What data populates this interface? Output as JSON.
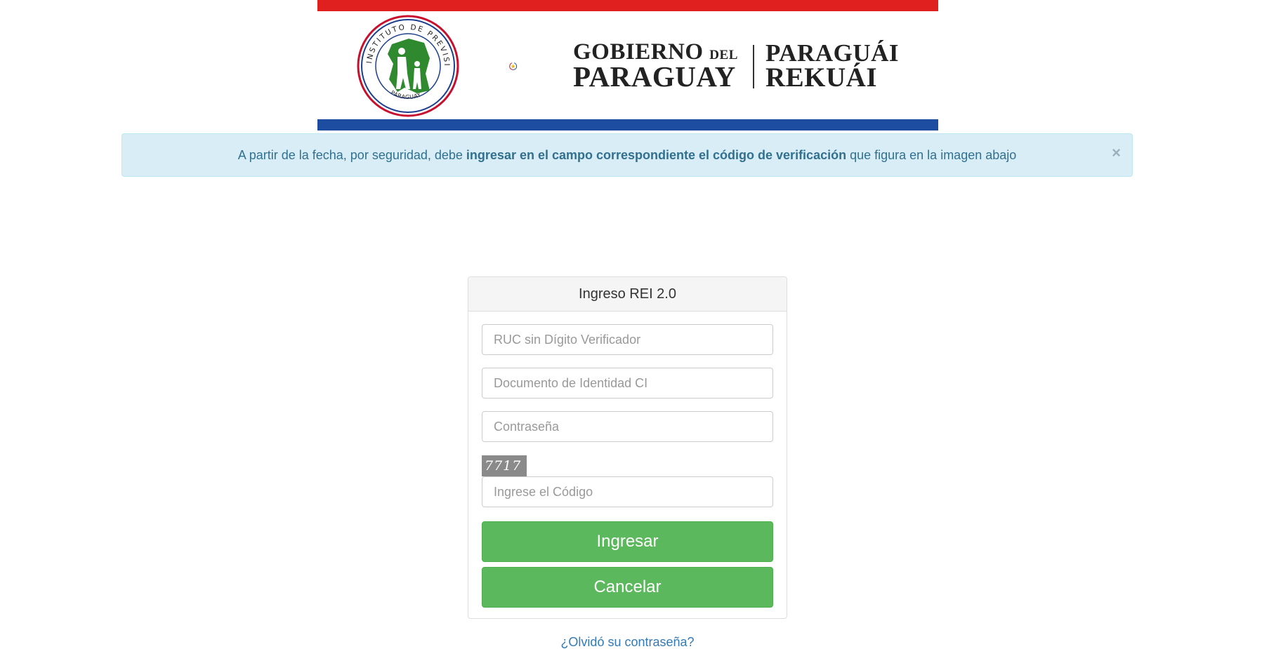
{
  "banner": {
    "ips_seal_text_top": "INSTITUTO DE PREVISION SOCIAL",
    "ips_seal_text_bottom": "PARAGUAY",
    "gov_line1": "GOBIERNO",
    "gov_line1_small": "DEL",
    "gov_line2": "PARAGUAY",
    "gov_line3": "PARAGUÁI",
    "gov_line4": "REKUÁI",
    "colors": {
      "red": "#e01f1f",
      "blue": "#1c4da1"
    }
  },
  "alert": {
    "text_before": "A partir de la fecha, por seguridad, debe ",
    "text_bold": "ingresar en el campo correspondiente el código de verificación",
    "text_after": " que figura en la imagen abajo",
    "close_label": "×"
  },
  "login": {
    "title": "Ingreso REI 2.0",
    "ruc_placeholder": "RUC sin Dígito Verificador",
    "ci_placeholder": "Documento de Identidad CI",
    "password_placeholder": "Contraseña",
    "captcha_text": "7717",
    "code_placeholder": "Ingrese el Código",
    "submit_label": "Ingresar",
    "cancel_label": "Cancelar",
    "forgot_label": "¿Olvidó su contraseña?"
  }
}
